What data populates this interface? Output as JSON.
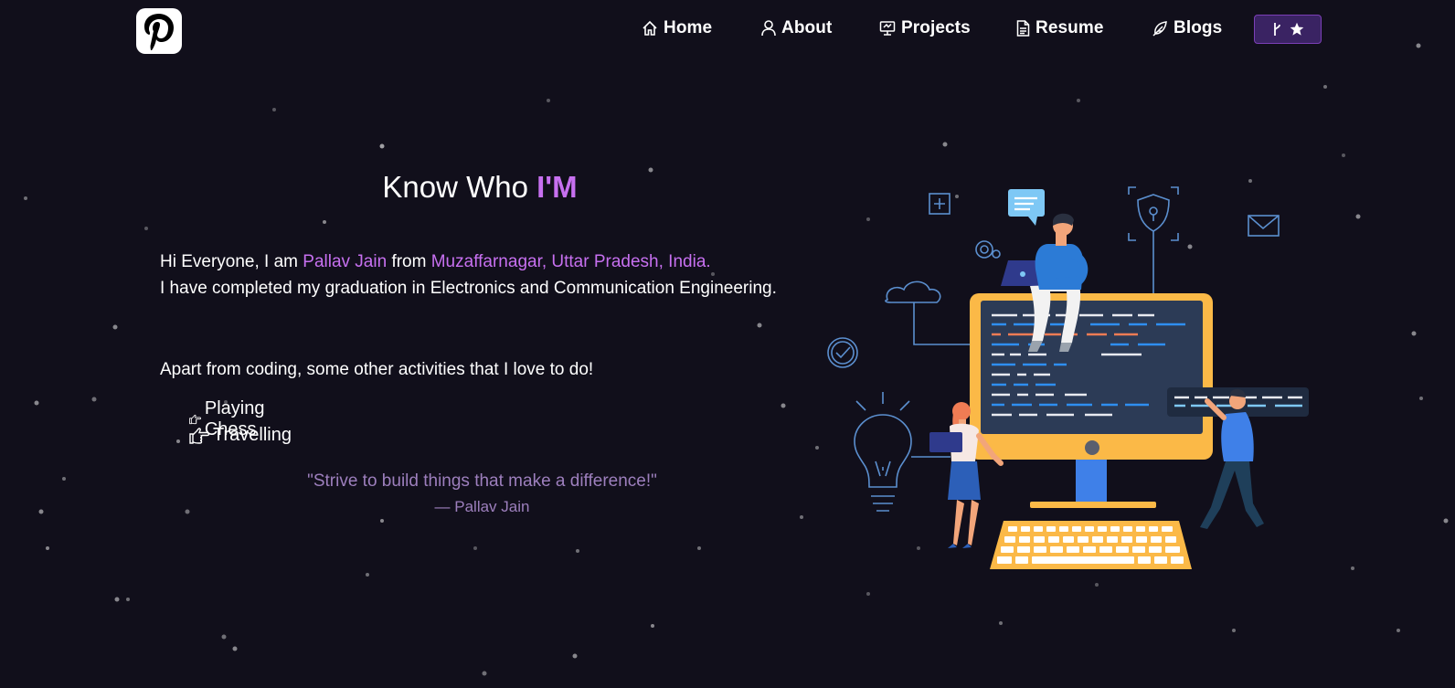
{
  "nav": {
    "items": [
      {
        "label": "Home",
        "icon": "home-icon"
      },
      {
        "label": "About",
        "icon": "user-icon"
      },
      {
        "label": "Projects",
        "icon": "presentation-icon"
      },
      {
        "label": "Resume",
        "icon": "document-icon"
      },
      {
        "label": "Blogs",
        "icon": "feather-icon"
      }
    ],
    "logo_icon": "pinterest-icon",
    "fork_icons": [
      "git-fork-icon",
      "star-icon"
    ]
  },
  "about": {
    "heading_prefix": "Know Who ",
    "heading_accent": "I'M",
    "intro_greeting": "Hi Everyone, I am ",
    "name": "Pallav Jain",
    "from": " from ",
    "location": "Muzaffarnagar, Uttar Pradesh, India.",
    "education": "I have completed my graduation in Electronics and Communication Engineering.",
    "activities_intro": "Apart from coding, some other activities that I love to do!",
    "activities": [
      "Playing Chess",
      "Travelling"
    ],
    "activity_icon": "pointing-hand-icon",
    "quote": "\"Strive to build things that make a difference!\"",
    "quote_author": "— Pallav Jain"
  },
  "colors": {
    "background": "#110f1b",
    "accent": "#c770f0",
    "quote": "#9d7fbd",
    "fork_button": "#3a2363"
  }
}
